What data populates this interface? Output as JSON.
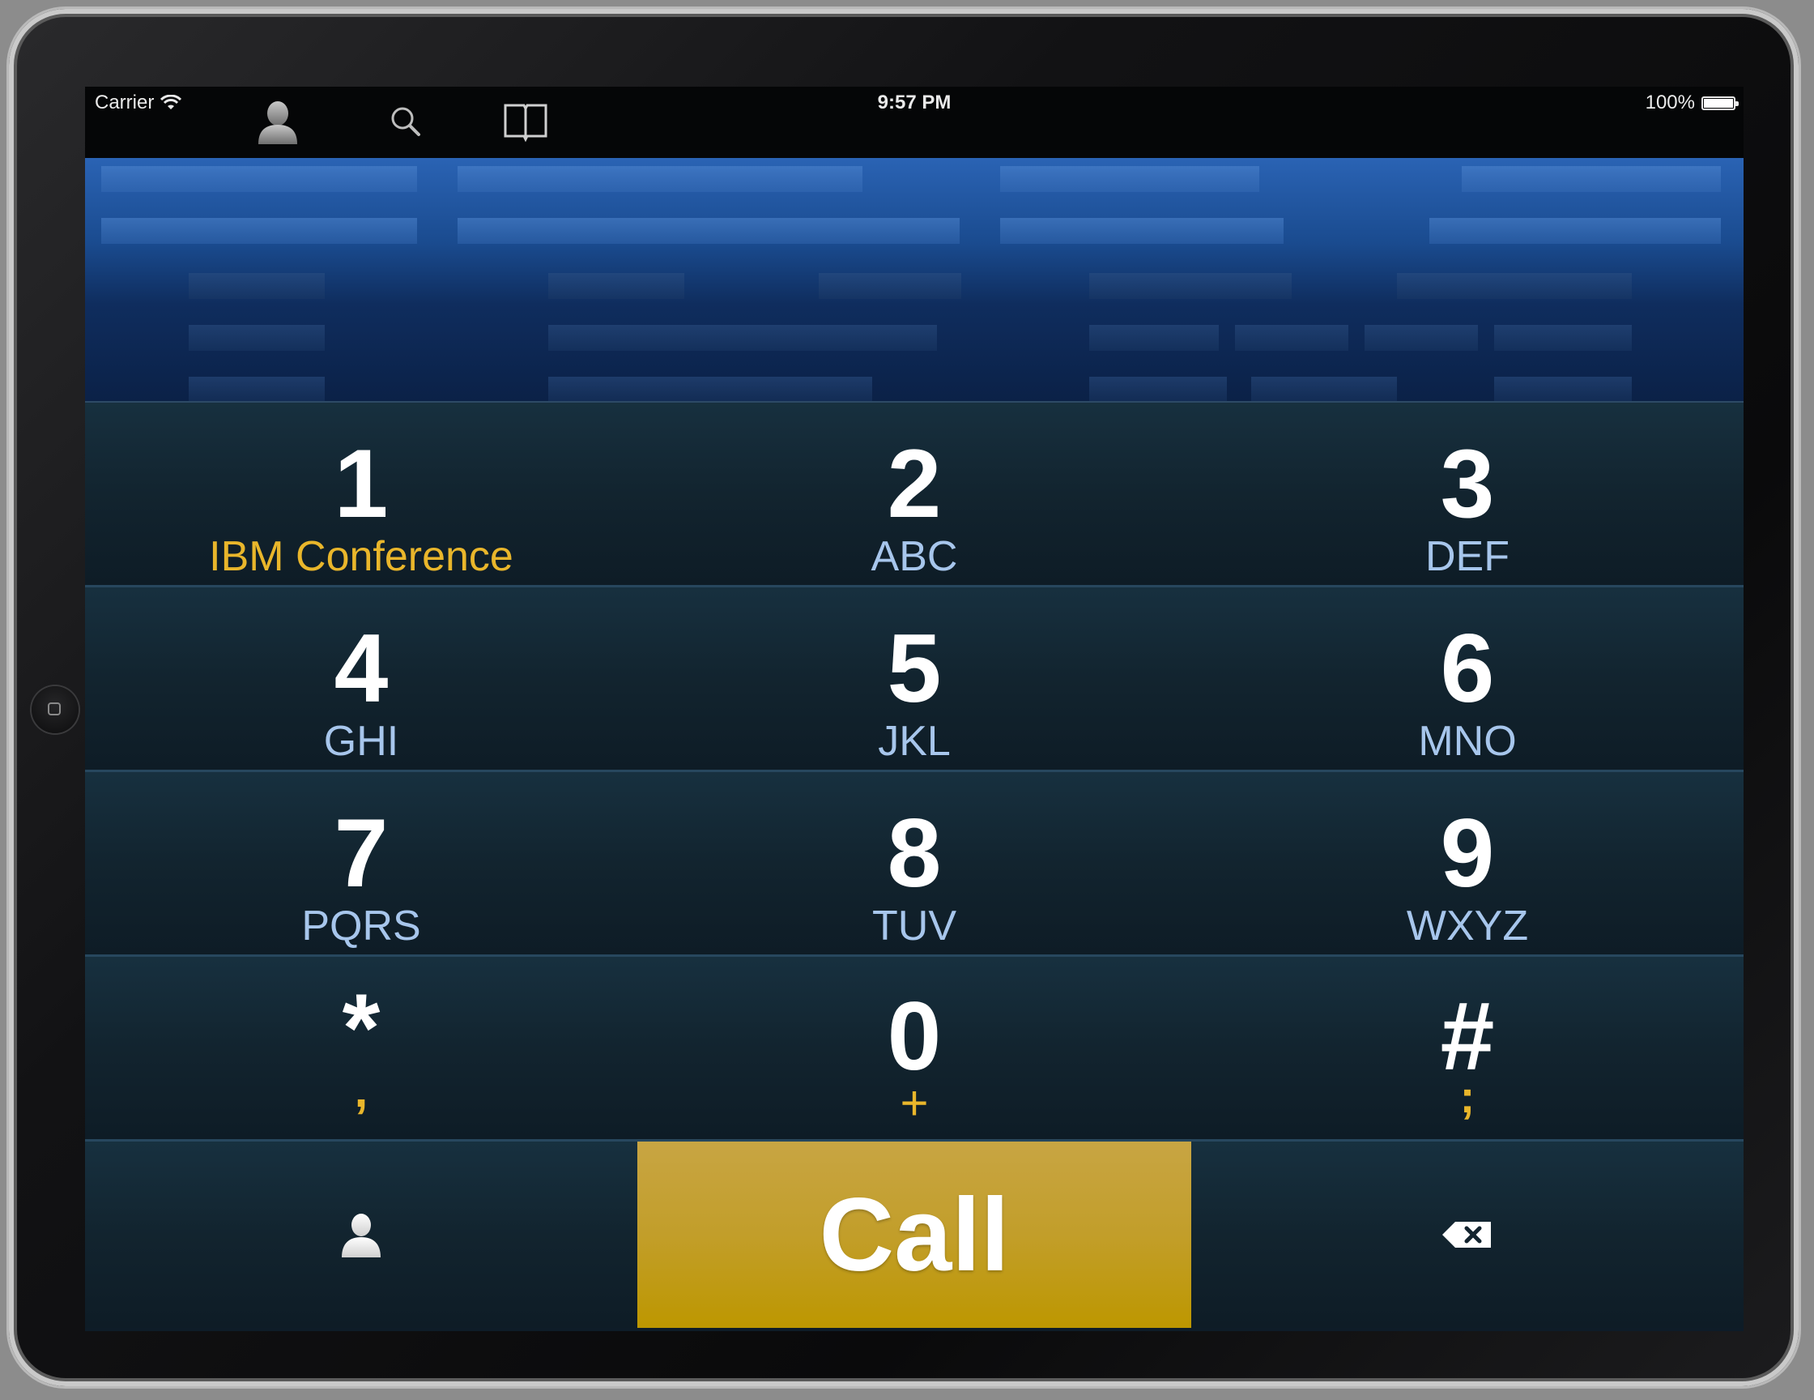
{
  "statusbar": {
    "carrier": "Carrier",
    "time": "9:57 PM",
    "battery": "100%",
    "battery_level": 1.0
  },
  "toolbar": {
    "icons": [
      "contacts-icon",
      "search-icon",
      "book-icon"
    ]
  },
  "banner": {
    "logo": "IBM"
  },
  "keypad": {
    "keys": [
      {
        "digit": "1",
        "letters": "IBM Conference"
      },
      {
        "digit": "2",
        "letters": "ABC"
      },
      {
        "digit": "3",
        "letters": "DEF"
      },
      {
        "digit": "4",
        "letters": "GHI"
      },
      {
        "digit": "5",
        "letters": "JKL"
      },
      {
        "digit": "6",
        "letters": "MNO"
      },
      {
        "digit": "7",
        "letters": "PQRS"
      },
      {
        "digit": "8",
        "letters": "TUV"
      },
      {
        "digit": "9",
        "letters": "WXYZ"
      },
      {
        "digit": "*",
        "letters": ","
      },
      {
        "digit": "0",
        "letters": "+"
      },
      {
        "digit": "#",
        "letters": ";"
      }
    ],
    "call_label": "Call"
  },
  "colors": {
    "accent_gold": "#e9b62b",
    "letters_blue": "#a7c6ec",
    "call_gold": "#c29e2a",
    "banner_blue": "#1a4b8f"
  }
}
